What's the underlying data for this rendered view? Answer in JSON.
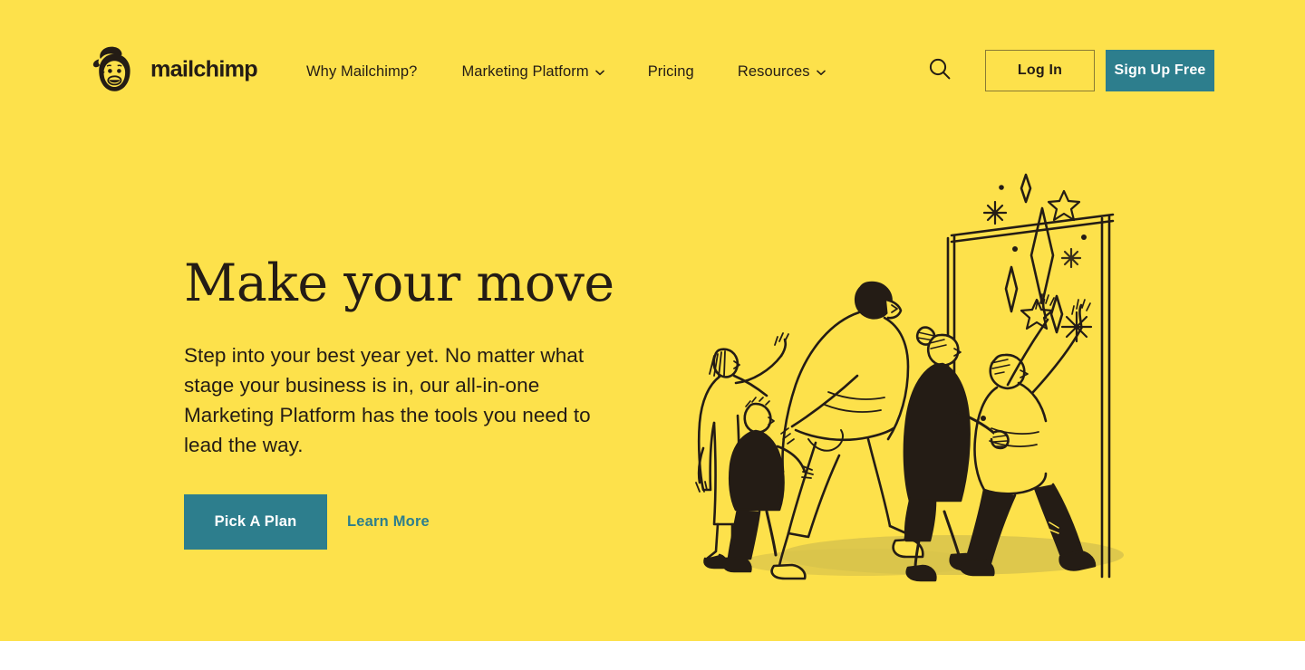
{
  "colors": {
    "brand_yellow": "#fde14b",
    "ink": "#241c15",
    "teal": "#2d7e8d",
    "white": "#ffffff",
    "login_border": "#8a7a33",
    "shadow_olive": "#d6c04a"
  },
  "header": {
    "logo": {
      "mark_name": "mailchimp-freddie-icon",
      "wordmark": "mailchimp"
    },
    "nav": [
      {
        "label": "Why Mailchimp?",
        "has_dropdown": false
      },
      {
        "label": "Marketing Platform",
        "has_dropdown": true
      },
      {
        "label": "Pricing",
        "has_dropdown": false
      },
      {
        "label": "Resources",
        "has_dropdown": true
      }
    ],
    "search": {
      "icon": "search-icon",
      "aria_label": "Search"
    },
    "login_label": "Log In",
    "signup_label": "Sign Up Free"
  },
  "hero": {
    "title": "Make your move",
    "subtitle": "Step into your best year yet. No matter what stage your business is in, our all-in-one Marketing Platform has the tools you need to lead the way.",
    "primary_cta": "Pick A Plan",
    "secondary_cta": "Learn More",
    "illustration": {
      "name": "people-walking-through-doorway-toward-stars-illustration",
      "description": "Line-art illustration of five people striding toward an open doorway with sparkles and stars beyond it"
    }
  }
}
